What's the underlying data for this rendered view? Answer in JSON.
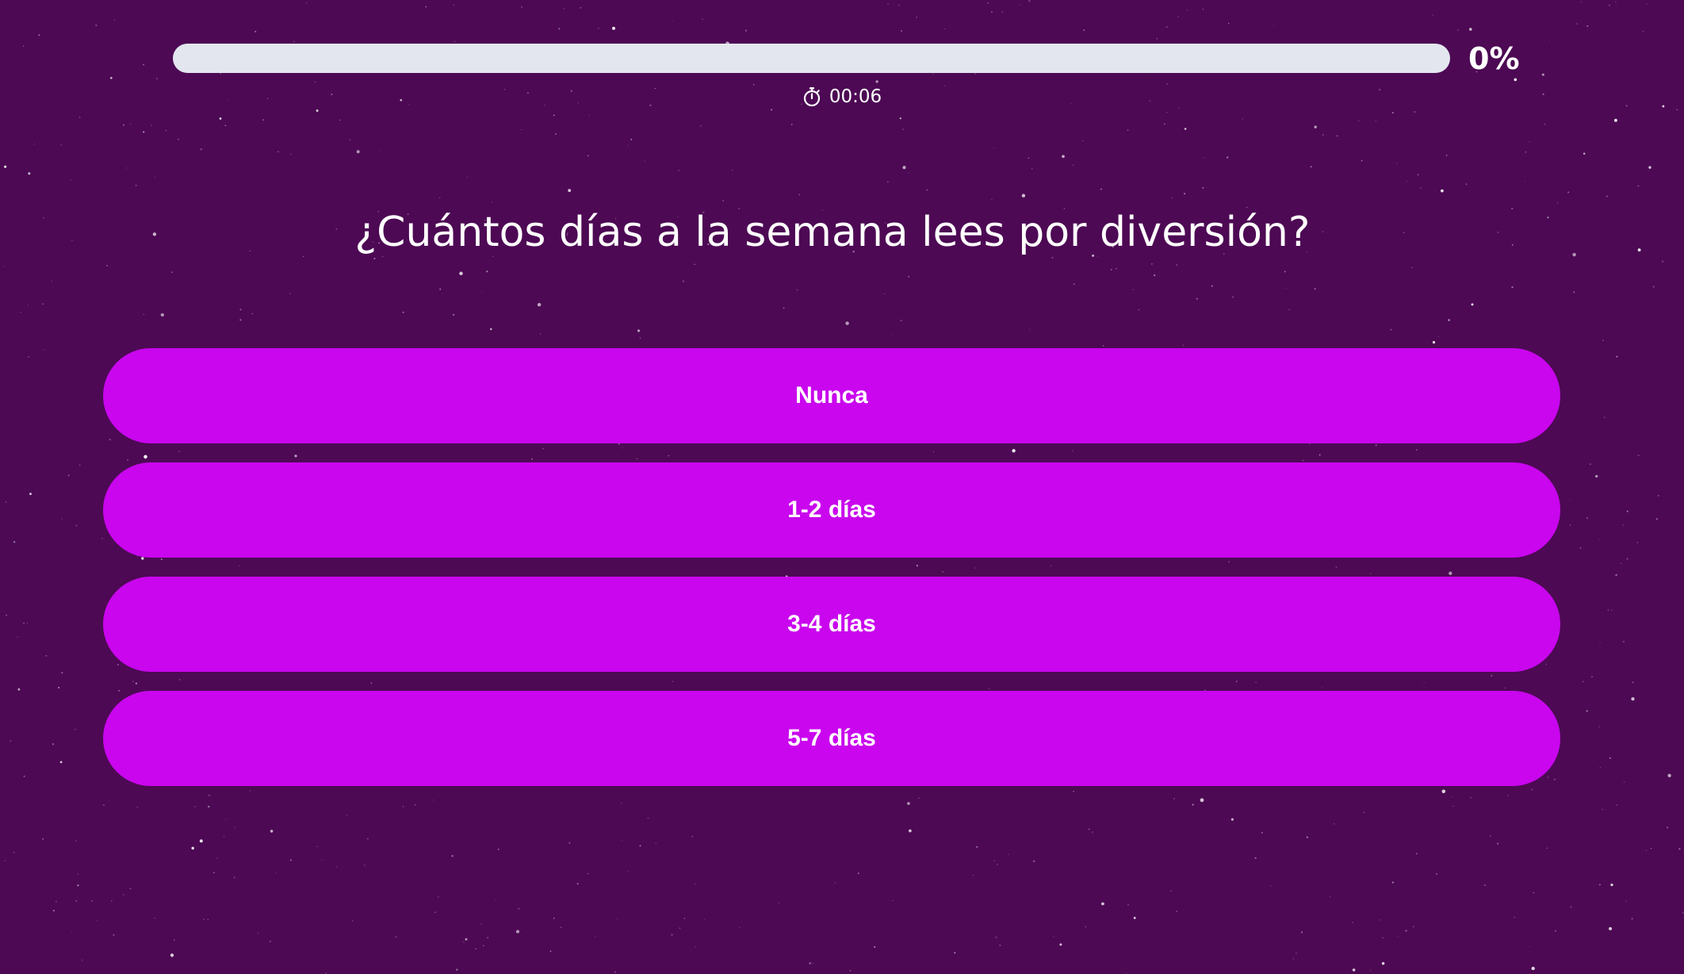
{
  "progress": {
    "percent_label": "0%",
    "value_percent": 0
  },
  "timer": {
    "icon": "stopwatch-icon",
    "elapsed": "00:06"
  },
  "question": {
    "text": "¿Cuántos días a la semana lees por diversión?"
  },
  "answers": [
    {
      "label": "Nunca"
    },
    {
      "label": "1-2 días"
    },
    {
      "label": "3-4 días"
    },
    {
      "label": "5-7 días"
    }
  ],
  "colors": {
    "background": "#4d0954",
    "answer_button": "#c906ee",
    "progress_track": "#e3e6ef",
    "text": "#ffffff"
  }
}
